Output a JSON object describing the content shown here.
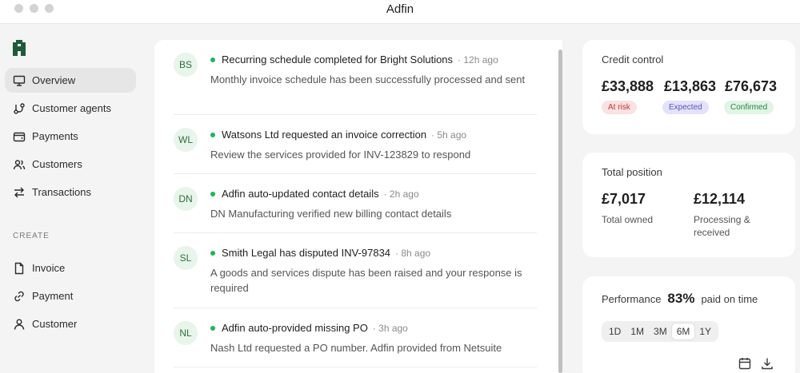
{
  "window": {
    "title": "Adfin"
  },
  "sidebar": {
    "items": [
      {
        "label": "Overview",
        "icon": "monitor-icon"
      },
      {
        "label": "Customer agents",
        "icon": "agents-icon"
      },
      {
        "label": "Payments",
        "icon": "wallet-icon"
      },
      {
        "label": "Customers",
        "icon": "users-icon"
      },
      {
        "label": "Transactions",
        "icon": "arrows-icon"
      }
    ],
    "create_label": "CREATE",
    "create_items": [
      {
        "label": "Invoice",
        "icon": "file-icon"
      },
      {
        "label": "Payment",
        "icon": "link-icon"
      },
      {
        "label": "Customer",
        "icon": "user-icon"
      }
    ]
  },
  "feed": {
    "items": [
      {
        "initials": "BS",
        "title": "Recurring schedule completed for Bright Solutions",
        "time": "· 12h ago",
        "description": "Monthly invoice schedule has been successfully processed and sent"
      },
      {
        "initials": "WL",
        "title": "Watsons Ltd requested an invoice correction",
        "time": "· 5h ago",
        "description": "Review the services provided for INV-123829 to respond"
      },
      {
        "initials": "DN",
        "title": "Adfin auto-updated contact details",
        "time": "· 2h ago",
        "description": "DN Manufacturing verified new billing contact details"
      },
      {
        "initials": "SL",
        "title": "Smith Legal has disputed INV-97834",
        "time": "· 8h ago",
        "description": "A goods and services dispute has been raised and your response is required"
      },
      {
        "initials": "NL",
        "title": "Adfin auto-provided missing PO",
        "time": "· 3h ago",
        "description": "Nash Ltd requested a PO number. Adfin provided from Netsuite"
      }
    ]
  },
  "credit_control": {
    "title": "Credit control",
    "amounts": [
      {
        "value": "£33,888",
        "badge": "At risk"
      },
      {
        "value": "£13,863",
        "badge": "Expected"
      },
      {
        "value": "£76,673",
        "badge": "Confirmed"
      }
    ]
  },
  "total_position": {
    "title": "Total position",
    "owned_value": "£7,017",
    "owned_label": "Total owned",
    "processing_value": "£12,114",
    "processing_label": "Processing & received"
  },
  "performance": {
    "label": "Performance",
    "percent": "83%",
    "suffix": "paid on time",
    "ranges": [
      "1D",
      "1M",
      "3M",
      "6M",
      "1Y"
    ],
    "active_range": "6M"
  },
  "colors": {
    "accent_green": "#1fb55a",
    "at_risk": "#b63a3a",
    "expected": "#5a54b8",
    "confirmed": "#2f8046"
  }
}
